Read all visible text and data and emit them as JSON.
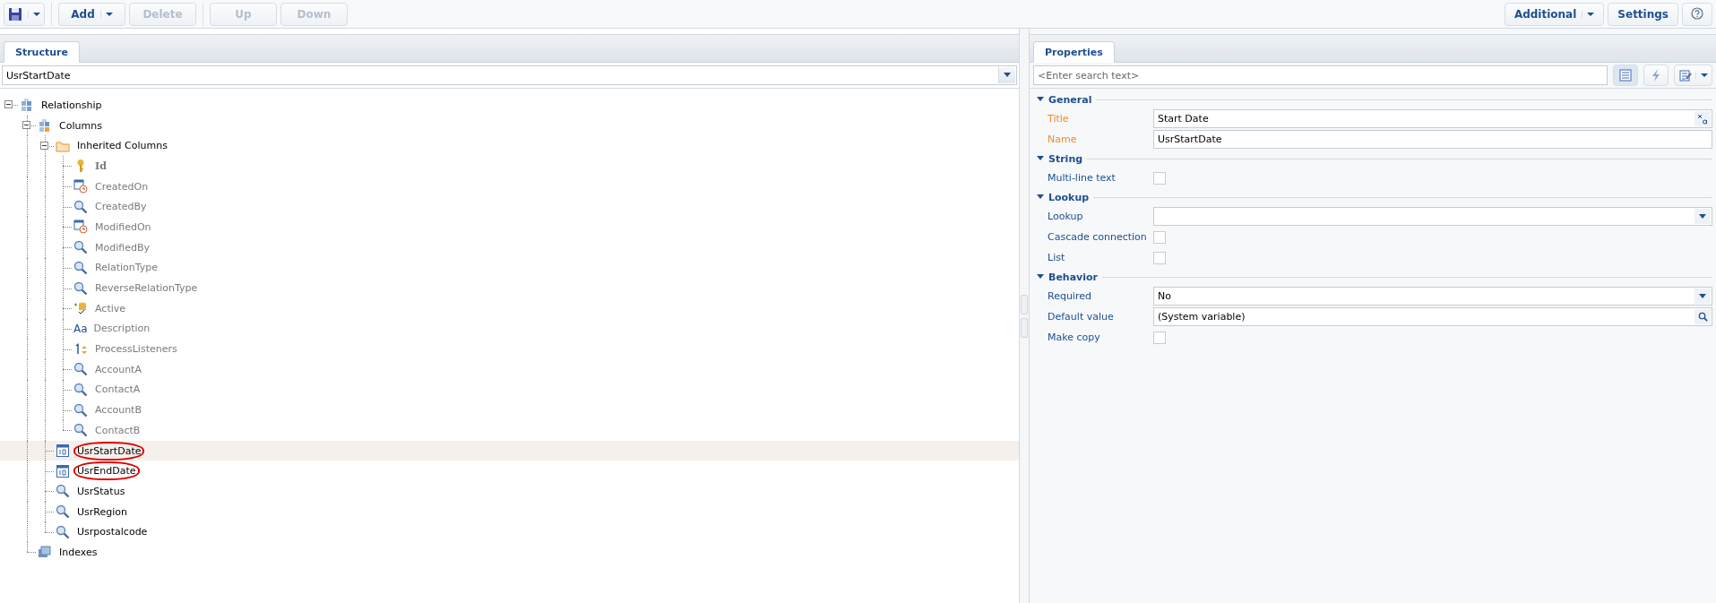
{
  "toolbar": {
    "left": [
      {
        "kind": "save",
        "menu": true,
        "disabled": false
      },
      {
        "kind": "text",
        "label": "Add",
        "menu": true,
        "disabled": false
      },
      {
        "kind": "text",
        "label": "Delete",
        "menu": false,
        "disabled": true
      },
      {
        "kind": "text",
        "label": "Up",
        "menu": false,
        "disabled": true
      },
      {
        "kind": "text",
        "label": "Down",
        "menu": false,
        "disabled": true
      }
    ],
    "right": [
      {
        "kind": "text",
        "label": "Additional",
        "menu": true,
        "disabled": false
      },
      {
        "kind": "text",
        "label": "Settings",
        "menu": false,
        "disabled": false
      },
      {
        "kind": "help",
        "menu": false,
        "disabled": false
      }
    ]
  },
  "structure": {
    "tabs": [
      {
        "label": "Structure",
        "selected": true
      }
    ],
    "selector": {
      "value": "UsrStartDate"
    },
    "tree": [
      {
        "label": "Relationship",
        "kind": "entity",
        "expanded": true,
        "children": [
          {
            "label": "Columns",
            "kind": "columns",
            "expanded": true,
            "children": [
              {
                "label": "Inherited Columns",
                "kind": "folder",
                "expanded": true,
                "children": [
                  {
                    "label": "Id",
                    "kind": "key",
                    "inherited": true,
                    "bold": true
                  },
                  {
                    "label": "CreatedOn",
                    "kind": "datetime",
                    "inherited": true
                  },
                  {
                    "label": "CreatedBy",
                    "kind": "lookup",
                    "inherited": true
                  },
                  {
                    "label": "ModifiedOn",
                    "kind": "datetime",
                    "inherited": true
                  },
                  {
                    "label": "ModifiedBy",
                    "kind": "lookup",
                    "inherited": true
                  },
                  {
                    "label": "RelationType",
                    "kind": "lookup",
                    "inherited": true
                  },
                  {
                    "label": "ReverseRelationType",
                    "kind": "lookup",
                    "inherited": true
                  },
                  {
                    "label": "Active",
                    "kind": "boolean",
                    "inherited": true
                  },
                  {
                    "label": "Description",
                    "kind": "text",
                    "glyph": "Aa",
                    "inherited": true
                  },
                  {
                    "label": "ProcessListeners",
                    "kind": "integer",
                    "inherited": true
                  },
                  {
                    "label": "AccountA",
                    "kind": "lookup",
                    "inherited": true
                  },
                  {
                    "label": "ContactA",
                    "kind": "lookup",
                    "inherited": true
                  },
                  {
                    "label": "AccountB",
                    "kind": "lookup",
                    "inherited": true
                  },
                  {
                    "label": "ContactB",
                    "kind": "lookup",
                    "inherited": true
                  }
                ]
              },
              {
                "label": "UsrStartDate",
                "kind": "date",
                "selected": true,
                "circled": true
              },
              {
                "label": "UsrEndDate",
                "kind": "date",
                "selected": false,
                "circled": true
              },
              {
                "label": "UsrStatus",
                "kind": "lookup"
              },
              {
                "label": "UsrRegion",
                "kind": "lookup"
              },
              {
                "label": "Usrpostalcode",
                "kind": "lookup"
              }
            ]
          },
          {
            "label": "Indexes",
            "kind": "indexes"
          }
        ]
      }
    ]
  },
  "properties": {
    "tabs": [
      {
        "label": "Properties",
        "selected": true
      }
    ],
    "search": {
      "placeholder": "<Enter search text>"
    },
    "view_buttons": [
      {
        "kind": "list",
        "selected": true,
        "menu": false
      },
      {
        "kind": "lightning",
        "selected": false,
        "menu": false
      },
      {
        "kind": "edit",
        "selected": false,
        "menu": true
      }
    ],
    "sections": [
      {
        "title": "General",
        "expanded": true,
        "rows": [
          {
            "kind": "text",
            "label": "Title",
            "required": true,
            "value": "Start Date",
            "localizable": true
          },
          {
            "kind": "text",
            "label": "Name",
            "required": true,
            "value": "UsrStartDate"
          }
        ]
      },
      {
        "title": "String",
        "expanded": true,
        "rows": [
          {
            "kind": "checkbox",
            "label": "Multi-line text",
            "checked": false
          }
        ]
      },
      {
        "title": "Lookup",
        "expanded": true,
        "rows": [
          {
            "kind": "select",
            "label": "Lookup"
          },
          {
            "kind": "checkbox",
            "label": "Cascade connection",
            "checked": false
          },
          {
            "kind": "checkbox",
            "label": "List",
            "checked": false
          }
        ]
      },
      {
        "title": "Behavior",
        "expanded": true,
        "rows": [
          {
            "kind": "select",
            "label": "Required",
            "value": "No"
          },
          {
            "kind": "lookup",
            "label": "Default value",
            "value": "(System variable)"
          },
          {
            "kind": "checkbox",
            "label": "Make copy",
            "checked": false
          }
        ]
      }
    ]
  }
}
